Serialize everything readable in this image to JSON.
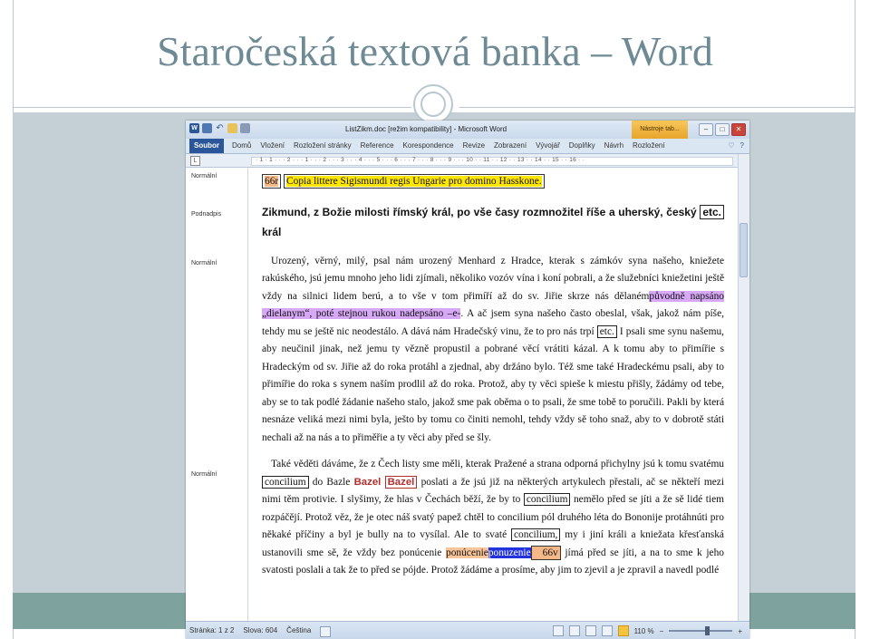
{
  "slide": {
    "title": "Staročeská textová banka – Word"
  },
  "window": {
    "doc_title": "ListZikm.doc [režim kompatibility] - Microsoft Word",
    "tools_tab": "Nástroje tab...",
    "minimize": "–",
    "maximize": "□",
    "close": "✕"
  },
  "ribbon": {
    "tabs": [
      "Soubor",
      "Domů",
      "Vložení",
      "Rozložení stránky",
      "Reference",
      "Korespondence",
      "Revize",
      "Zobrazení",
      "Vývojář",
      "Doplňky",
      "Návrh",
      "Rozložení"
    ]
  },
  "ruler": {
    "tab_selector": "L",
    "scale": "· 1 · 1 · · · 2 · · · 1 · · · 2 · · · 3 · · · 4 · · · 5 · · · 6 · · · 7 · · · 8 · · · 9 · · · 10 · · 11 · · 12 · · 13 · · 14 · · 15 · · 16 · ·"
  },
  "styles": [
    "Normální",
    "Podnadpis",
    "Normální",
    "Normální"
  ],
  "document": {
    "p1_folio": "66r",
    "p1_title": "Copia littere Sigismundi regis Ungarie pro domino Hasskone.",
    "h_a": "Zikmund, z Božie milosti římský král, po vše časy rozmnožitel říše a uherský, český ",
    "h_etc": "etc.",
    "h_b": " král",
    "p2_a": "Urozený, věrný, milý, psal nám urozený Menhard z Hradce, kterak s zámkóv syna našeho, kniežete rakúského, jsú jemu mnoho jeho lidi zjímali, několiko vozóv vína i koní pobrali, a že služebníci kniežetini ještě vždy na silnici lidem berú, a to vše v tom přimíří až do sv. Jiřie skrze nás dělaném",
    "p2_hl": "původně napsáno „dielanym“, poté stejnou rukou nadepsáno –e-",
    "p2_b": ". A ač jsem syna našeho často obeslal, však, jakož nám píše, tehdy mu se ještě nic neodestálo. A dává nám Hradečský vinu, že to pro nás trpí ",
    "p2_etc": "etc.",
    "p2_c": " I psali sme synu našemu, aby neučinil jinak, než jemu ty vězně propustil a pobrané věcí vrátiti kázal. A k tomu aby to přimířie s Hradeckým od sv. Jiřie až do roka protáhl a zjednal, aby držáno bylo. Též sme také Hradeckému psali, aby to přimířie do roka s synem naším prodlil až do roka. Protož, aby ty věci spieše k miestu přišly, žádámy od tebe, aby se to tak podlé žádanie našeho stalo, jakož sme pak oběma o to psali, že sme tobě to poručili. Pakli by která nesnáze veliká mezi nimi byla, ješto by tomu co činiti nemohl, tehdy vždy sě toho snaž, aby to v dobrotě státi nechali až na nás a to přiměřie a ty věci aby před se šly.",
    "p3_a": "Také věděti dáváme, že z Čech listy sme měli, kterak Pražené a strana odporná přichylny jsú k tomu svatému ",
    "p3_concilium1": "concilium",
    "p3_b": " do Bazle ",
    "p3_bazel1": "Bazel",
    "p3_bazel2": "Bazel",
    "p3_c": " poslati a že jsú již na některých artykulech přestali, ač se někteří mezi nimi těm protivie. I slyšimy, že hlas v Čechách běží, že by to ",
    "p3_concilium2": "concilium",
    "p3_d": " nemělo před se jíti a že sě lidé tiem rozpáčějí. Protož věz, že je otec náš svatý papež chtěl to concilium pól druhého léta do Bononije protáhnúti pro někaké příčiny a byl je bully na to vysílal. Ale to svaté ",
    "p3_concilium3": "concilium,",
    "p3_e": " my i jiní králi a kniežata křesťanská ustanovili sme sě, že vždy bez ponúcenie ",
    "p3_ponucenie1": "ponúcenie",
    "p3_ponucenie2": "ponuzenie",
    "p3_folio": "66v",
    "p3_f": " jímá před se jíti, a na to sme k jeho svatosti poslali a tak že to před se pójde. Protož žádáme a prosíme, aby jim to zjevil a je zpravil a navedl podlé"
  },
  "status": {
    "page": "Stránka: 1 z 2",
    "words": "Slova: 604",
    "lang": "Čeština",
    "zoom": "110 %",
    "zoom_minus": "−",
    "zoom_plus": "+"
  }
}
